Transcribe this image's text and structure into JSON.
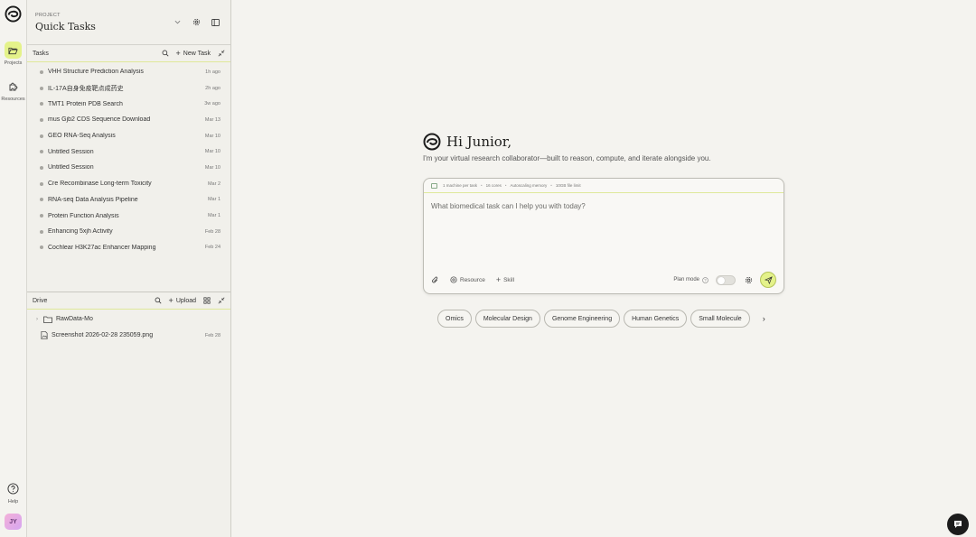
{
  "rail": {
    "projects_label": "Projects",
    "resources_label": "Resources",
    "help_label": "Help",
    "avatar_initials": "JY"
  },
  "project": {
    "label": "PROJECT",
    "name": "Quick Tasks"
  },
  "tasks": {
    "title": "Tasks",
    "new_task_label": "New Task",
    "items": [
      {
        "name": "VHH Structure Prediction Analysis",
        "time": "1h ago"
      },
      {
        "name": "IL-17A自身免疫靶点成药史",
        "time": "2h ago"
      },
      {
        "name": "TMT1 Protein PDB Search",
        "time": "3w ago"
      },
      {
        "name": "mus Gjb2 CDS Sequence Download",
        "time": "Mar 13"
      },
      {
        "name": "GEO RNA-Seq Analysis",
        "time": "Mar 10"
      },
      {
        "name": "Untitled Session",
        "time": "Mar 10"
      },
      {
        "name": "Untitled Session",
        "time": "Mar 10"
      },
      {
        "name": "Cre Recombinase Long-term Toxicity",
        "time": "Mar 2"
      },
      {
        "name": "RNA-seq Data Analysis Pipeline",
        "time": "Mar 1"
      },
      {
        "name": "Protein Function Analysis",
        "time": "Mar 1"
      },
      {
        "name": "Enhancing 5xjh Activity",
        "time": "Feb 28"
      },
      {
        "name": "Cochlear H3K27ac Enhancer Mapping",
        "time": "Feb 24"
      }
    ]
  },
  "drive": {
    "title": "Drive",
    "upload_label": "Upload",
    "items": [
      {
        "name": "RawData-Mo",
        "time": "",
        "type": "folder"
      },
      {
        "name": "Screenshot 2026-02-28 235059.png",
        "time": "Feb 28",
        "type": "file"
      }
    ]
  },
  "main": {
    "greeting": "Hi Junior,",
    "subtitle": "I'm your virtual research collaborator—built to reason, compute, and iterate alongside you.",
    "meta": [
      "1 machine per task",
      "16 cores",
      "Autoscaling memory",
      "10GB file limit"
    ],
    "placeholder": "What biomedical task can I help you with today?",
    "resource_label": "Resource",
    "skill_label": "Skill",
    "plan_mode_label": "Plan mode",
    "chips": [
      "Omics",
      "Molecular Design",
      "Genome Engineering",
      "Human Genetics",
      "Small Molecule"
    ]
  },
  "colors": {
    "accent": "#e4f28a",
    "background": "#f4f3ef"
  }
}
